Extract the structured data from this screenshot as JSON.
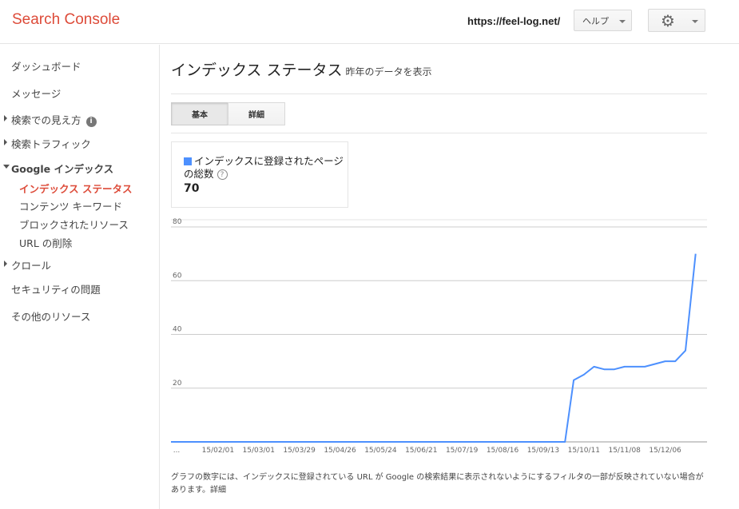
{
  "header": {
    "logo": "Search Console",
    "site_url": "https://feel-log.net/",
    "help_label": "ヘルプ",
    "settings_icon": "gear-icon"
  },
  "sidebar": {
    "items": [
      {
        "label": "ダッシュボード"
      },
      {
        "label": "メッセージ"
      },
      {
        "label": "検索での見え方",
        "expander": "collapsed",
        "info_icon": "i"
      },
      {
        "label": "検索トラフィック",
        "expander": "collapsed"
      },
      {
        "label": "Google インデックス",
        "expander": "expanded"
      },
      {
        "label": "クロール",
        "expander": "collapsed"
      },
      {
        "label": "セキュリティの問題"
      },
      {
        "label": "その他のリソース"
      }
    ],
    "subitems": [
      {
        "label": "インデックス ステータス",
        "active": true
      },
      {
        "label": "コンテンツ キーワード"
      },
      {
        "label": "ブロックされたリソース"
      },
      {
        "label": "URL の削除"
      }
    ]
  },
  "main": {
    "title": "インデックス ステータス",
    "subtitle": "昨年のデータを表示",
    "tabs": [
      {
        "label": "基本",
        "selected": true
      },
      {
        "label": "詳細",
        "selected": false
      }
    ],
    "metric": {
      "label": "インデックスに登録されたページの総数",
      "help": "?",
      "value": "70",
      "color": "#4d90fe"
    },
    "footnote": "グラフの数字には、インデックスに登録されている URL が Google の検索結果に表示されないようにするフィルタの一部が反映されていない場合があります。",
    "footnote_link": "詳細"
  },
  "chart_data": {
    "type": "line",
    "x_tick_labels": [
      "...",
      "15/02/01",
      "15/03/01",
      "15/03/29",
      "15/04/26",
      "15/05/24",
      "15/06/21",
      "15/07/19",
      "15/08/16",
      "15/09/13",
      "15/10/11",
      "15/11/08",
      "15/12/06"
    ],
    "y_ticks": [
      20,
      40,
      60,
      80
    ],
    "ylim": [
      0,
      80
    ],
    "grid": true,
    "series": [
      {
        "color": "#4d90fe",
        "points": [
          {
            "x": "2015-01-01",
            "y": 0
          },
          {
            "x": "2015-09-28",
            "y": 0
          },
          {
            "x": "2015-10-04",
            "y": 23
          },
          {
            "x": "2015-10-11",
            "y": 25
          },
          {
            "x": "2015-10-18",
            "y": 28
          },
          {
            "x": "2015-10-25",
            "y": 27
          },
          {
            "x": "2015-11-01",
            "y": 27
          },
          {
            "x": "2015-11-08",
            "y": 28
          },
          {
            "x": "2015-11-15",
            "y": 28
          },
          {
            "x": "2015-11-22",
            "y": 28
          },
          {
            "x": "2015-11-29",
            "y": 29
          },
          {
            "x": "2015-12-06",
            "y": 30
          },
          {
            "x": "2015-12-13",
            "y": 30
          },
          {
            "x": "2015-12-20",
            "y": 34
          },
          {
            "x": "2015-12-27",
            "y": 70
          }
        ]
      }
    ]
  }
}
